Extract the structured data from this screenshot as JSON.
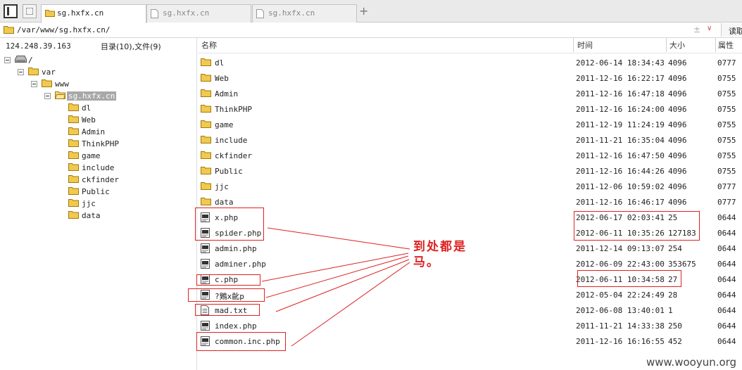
{
  "tabs": [
    {
      "label": "sg.hxfx.cn",
      "active": true
    },
    {
      "label": "sg.hxfx.cn",
      "active": false
    },
    {
      "label": "sg.hxfx.cn",
      "active": false
    }
  ],
  "new_tab_label": "+",
  "address": {
    "path": "/var/www/sg.hxfx.cn/",
    "actions": "± ∨",
    "read_button": "读取"
  },
  "left_pane": {
    "ip": "124.248.39.163",
    "counts": "目录(10),文件(9)",
    "tree": [
      {
        "label": "/",
        "icon": "drive-icon",
        "expanded": true
      },
      {
        "label": "var",
        "icon": "folder-icon",
        "expanded": true
      },
      {
        "label": "www",
        "icon": "folder-icon",
        "expanded": true
      },
      {
        "label": "sg.hxfx.cn",
        "icon": "folder-open-icon",
        "expanded": true,
        "selected": true
      },
      {
        "label": "dl",
        "icon": "folder-icon"
      },
      {
        "label": "Web",
        "icon": "folder-icon"
      },
      {
        "label": "Admin",
        "icon": "folder-icon"
      },
      {
        "label": "ThinkPHP",
        "icon": "folder-icon"
      },
      {
        "label": "game",
        "icon": "folder-icon"
      },
      {
        "label": "include",
        "icon": "folder-icon"
      },
      {
        "label": "ckfinder",
        "icon": "folder-icon"
      },
      {
        "label": "Public",
        "icon": "folder-icon"
      },
      {
        "label": "jjc",
        "icon": "folder-icon"
      },
      {
        "label": "data",
        "icon": "folder-icon"
      }
    ]
  },
  "columns": {
    "name": "名称",
    "time": "时间",
    "size": "大小",
    "perm": "属性"
  },
  "files": [
    {
      "name": "dl",
      "time": "2012-06-14 18:34:43",
      "size": "4096",
      "perm": "0777",
      "type": "folder"
    },
    {
      "name": "Web",
      "time": "2011-12-16 16:22:17",
      "size": "4096",
      "perm": "0755",
      "type": "folder"
    },
    {
      "name": "Admin",
      "time": "2011-12-16 16:47:18",
      "size": "4096",
      "perm": "0755",
      "type": "folder"
    },
    {
      "name": "ThinkPHP",
      "time": "2011-12-16 16:24:00",
      "size": "4096",
      "perm": "0755",
      "type": "folder"
    },
    {
      "name": "game",
      "time": "2011-12-19 11:24:19",
      "size": "4096",
      "perm": "0755",
      "type": "folder"
    },
    {
      "name": "include",
      "time": "2011-11-21 16:35:04",
      "size": "4096",
      "perm": "0755",
      "type": "folder"
    },
    {
      "name": "ckfinder",
      "time": "2011-12-16 16:47:50",
      "size": "4096",
      "perm": "0755",
      "type": "folder"
    },
    {
      "name": "Public",
      "time": "2011-12-16 16:44:26",
      "size": "4096",
      "perm": "0755",
      "type": "folder"
    },
    {
      "name": "jjc",
      "time": "2011-12-06 10:59:02",
      "size": "4096",
      "perm": "0777",
      "type": "folder"
    },
    {
      "name": "data",
      "time": "2011-12-16 16:46:17",
      "size": "4096",
      "perm": "0777",
      "type": "folder"
    },
    {
      "name": "x.php",
      "time": "2012-06-17 02:03:41",
      "size": "25",
      "perm": "0644",
      "type": "php"
    },
    {
      "name": "spider.php",
      "time": "2012-06-11 10:35:26",
      "size": "127183",
      "perm": "0644",
      "type": "php"
    },
    {
      "name": "admin.php",
      "time": "2011-12-14 09:13:07",
      "size": "254",
      "perm": "0644",
      "type": "php"
    },
    {
      "name": "adminer.php",
      "time": "2012-06-09 22:43:00",
      "size": "353675",
      "perm": "0644",
      "type": "php"
    },
    {
      "name": "c.php",
      "time": "2012-06-11 10:34:58",
      "size": "27",
      "perm": "0644",
      "type": "php"
    },
    {
      "name": "?鶪x齔p",
      "time": "2012-05-04 22:24:49",
      "size": "28",
      "perm": "0644",
      "type": "php"
    },
    {
      "name": "mad.txt",
      "time": "2012-06-08 13:40:01",
      "size": "1",
      "perm": "0644",
      "type": "txt"
    },
    {
      "name": "index.php",
      "time": "2011-11-21 14:33:38",
      "size": "250",
      "perm": "0644",
      "type": "php"
    },
    {
      "name": "common.inc.php",
      "time": "2011-12-16 16:16:55",
      "size": "452",
      "perm": "0644",
      "type": "php"
    }
  ],
  "annotation": "到处都是马。",
  "watermark": "www.wooyun.org",
  "colors": {
    "annotation_red": "#dd2222",
    "folder_yellow": "#f2c94c",
    "selection_gray": "#a8a8a8"
  }
}
